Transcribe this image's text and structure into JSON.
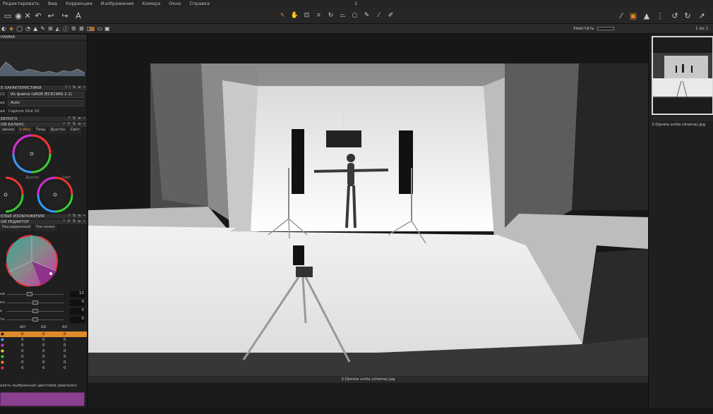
{
  "menu": {
    "items": [
      "Редактировать",
      "Вид",
      "Коррекции",
      "Изображение",
      "Камера",
      "Окно",
      "Справка"
    ],
    "page_number": "1"
  },
  "subbar": {
    "fit_label": "Уместить",
    "counter": "1 из 1"
  },
  "left_panel": {
    "histogram_title": "РАММА",
    "base_char_title": "Е ХАРАКТЕРИСТИКИ",
    "icc_label": "СС",
    "icc_value": "Из файла (sRGB IEC61966-2.1)",
    "curve_label": "ая",
    "curve_value": "Auto",
    "engine_label": "ая",
    "engine_value": "Capture One 10",
    "white_title": "БЕЛОГО",
    "wb_title": "ОЙ БАЛАНС",
    "wb_tabs": [
      "авная",
      "3-Way",
      "Тень",
      "Дуатон",
      "Свет"
    ],
    "wheel_label_mid": "Дуатон",
    "wheel_label_right": "Свет",
    "image_title": "ЕЛЫЕ ИЗОБРАЖЕНИЯ",
    "editor_title": "ОЙ РЕДАКТОР",
    "editor_tabs": [
      "Расширенный",
      "Тон кожи"
    ],
    "sliders": [
      {
        "label": "не",
        "value": "12"
      },
      {
        "label": "он",
        "value": "0"
      },
      {
        "label": "ь",
        "value": "0"
      },
      {
        "label": "ть",
        "value": "0"
      }
    ],
    "table_headers": [
      "ΔH",
      "ΔS",
      "ΔV"
    ],
    "table_rows": [
      {
        "h": "0",
        "s": "0",
        "v": "0"
      },
      {
        "h": "0",
        "s": "0",
        "v": "0"
      },
      {
        "h": "0",
        "s": "0",
        "v": "0"
      },
      {
        "h": "0",
        "s": "0",
        "v": "0"
      },
      {
        "h": "0",
        "s": "0",
        "v": "0"
      },
      {
        "h": "0",
        "s": "0",
        "v": "0"
      },
      {
        "h": "0",
        "s": "0",
        "v": "0"
      }
    ],
    "show_range": "азать выбранный цветовой диапазон"
  },
  "viewer": {
    "caption": "3.Djerela svitla (shema).jpg"
  },
  "right_panel": {
    "thumb_label": "3.Djerela svitla (shema).jpg"
  },
  "colors": {
    "accent": "#e08a2a",
    "selection_purple": "#8a3f8f"
  }
}
